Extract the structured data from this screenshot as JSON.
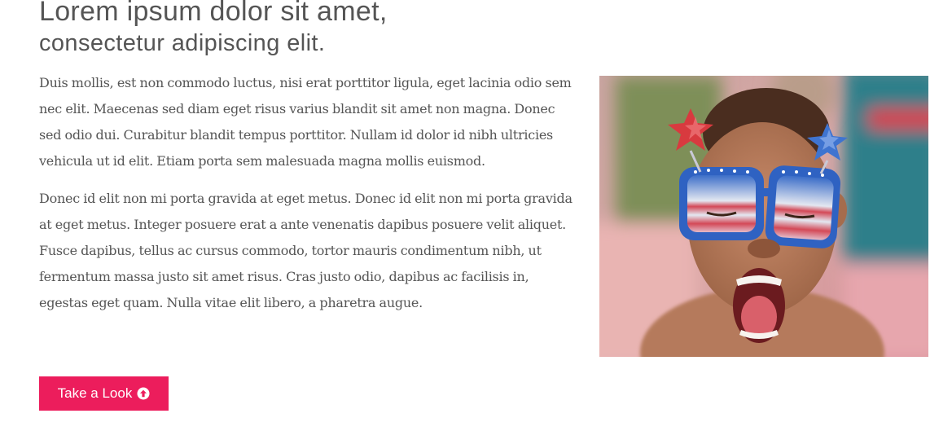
{
  "heading": {
    "line1": "Lorem ipsum dolor sit amet,",
    "line2": "consectetur adipiscing elit."
  },
  "paragraphs": [
    "Duis mollis, est non commodo luctus, nisi erat porttitor ligula, eget lacinia odio sem nec elit. Maecenas sed diam eget risus varius blandit sit amet non magna. Donec sed odio dui. Curabitur blandit tempus porttitor. Nullam id dolor id nibh ultricies vehicula ut id elit. Etiam porta sem malesuada magna mollis euismod.",
    "Donec id elit non mi porta gravida at eget metus. Donec id elit non mi porta gravida at eget metus. Integer posuere erat a ante venenatis dapibus posuere velit aliquet. Fusce dapibus, tellus ac cursus commodo, tortor mauris condimentum nibh, ut fermentum massa justo sit amet risus. Cras justo odio, dapibus ac facilisis in, egestas eget quam. Nulla vitae elit libero, a pharetra augue."
  ],
  "cta": {
    "label": "Take a Look",
    "icon": "circle-arrow-up-icon"
  },
  "image": {
    "subject": "child-with-star-glasses-photo"
  },
  "colors": {
    "accent": "#ec1d5c",
    "text": "#555555",
    "background": "#ffffff"
  }
}
